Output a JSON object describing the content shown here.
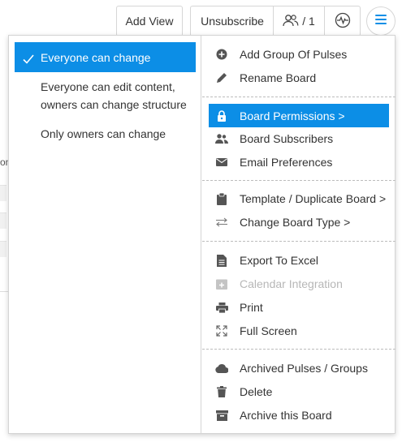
{
  "toolbar": {
    "add_view": "Add View",
    "unsubscribe": "Unsubscribe",
    "member_count": "/ 1"
  },
  "background": {
    "partial_text": "on"
  },
  "permissions": {
    "options": [
      {
        "label": "Everyone can change",
        "selected": true
      },
      {
        "label": "Everyone can edit content, owners can change structure",
        "selected": false
      },
      {
        "label": "Only owners can change",
        "selected": false
      }
    ]
  },
  "menu": {
    "add_group": "Add Group Of Pulses",
    "rename_board": "Rename Board",
    "board_permissions": "Board Permissions >",
    "board_subscribers": "Board Subscribers",
    "email_preferences": "Email Preferences",
    "template_duplicate": "Template / Duplicate Board >",
    "change_board_type": "Change Board Type >",
    "export_excel": "Export To Excel",
    "calendar_integration": "Calendar Integration",
    "print": "Print",
    "full_screen": "Full Screen",
    "archived": "Archived Pulses / Groups",
    "delete": "Delete",
    "archive_board": "Archive this Board"
  },
  "colors": {
    "accent": "#0c8ee6",
    "icon": "#555555",
    "disabled": "#b7b7b7"
  }
}
